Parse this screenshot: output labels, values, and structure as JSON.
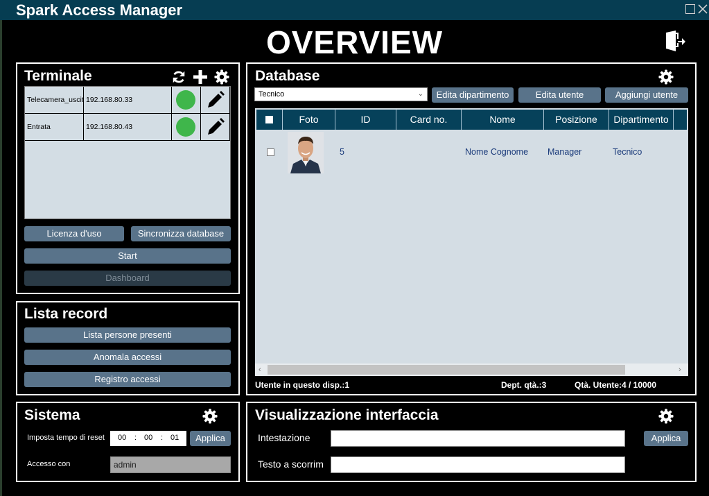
{
  "window": {
    "title": "Spark Access Manager"
  },
  "heading": "OVERVIEW",
  "terminale": {
    "title": "Terminale",
    "rows": [
      {
        "name": "Telecamera_uscita",
        "ip": "192.168.80.33"
      },
      {
        "name": "Entrata",
        "ip": "192.168.80.43"
      }
    ],
    "license_label": "Licenza d'uso",
    "sync_label": "Sincronizza database",
    "start_label": "Start",
    "dashboard_label": "Dashboard"
  },
  "lista_record": {
    "title": "Lista record",
    "present_label": "Lista persone presenti",
    "anomaly_label": "Anomala accessi",
    "log_label": "Registro accessi"
  },
  "sistema": {
    "title": "Sistema",
    "reset_label": "Imposta tempo di reset",
    "time": {
      "h": "00",
      "m": "00",
      "s": "01",
      "sep": ":"
    },
    "apply_label": "Applica",
    "access_label": "Accesso con",
    "access_value": "admin"
  },
  "database": {
    "title": "Database",
    "department_select": "Tecnico",
    "edit_dept_label": "Edita dipartimento",
    "edit_user_label": "Edita utente",
    "add_user_label": "Aggiungi utente",
    "columns": [
      "Foto",
      "ID",
      "Card no.",
      "Nome",
      "Posizione",
      "Dipartimento"
    ],
    "rows": [
      {
        "id": "5",
        "card": "",
        "name": "Nome Cognome",
        "position": "Manager",
        "department": "Tecnico"
      }
    ],
    "status_users_device": "Utente in questo disp.:1",
    "status_dept": "Dept. qtà.:3",
    "status_users": "Qtà. Utente:4 / 10000"
  },
  "visualizzazione": {
    "title": "Visualizzazione interfaccia",
    "header_label": "Intestazione",
    "header_value": "",
    "scroll_label": "Testo a scorrimento",
    "scroll_value": "",
    "apply_label": "Applica"
  },
  "colors": {
    "titlebar": "#063d52",
    "button": "#59738a",
    "grid_header": "#06415a",
    "status_ok": "#3fb64b"
  }
}
